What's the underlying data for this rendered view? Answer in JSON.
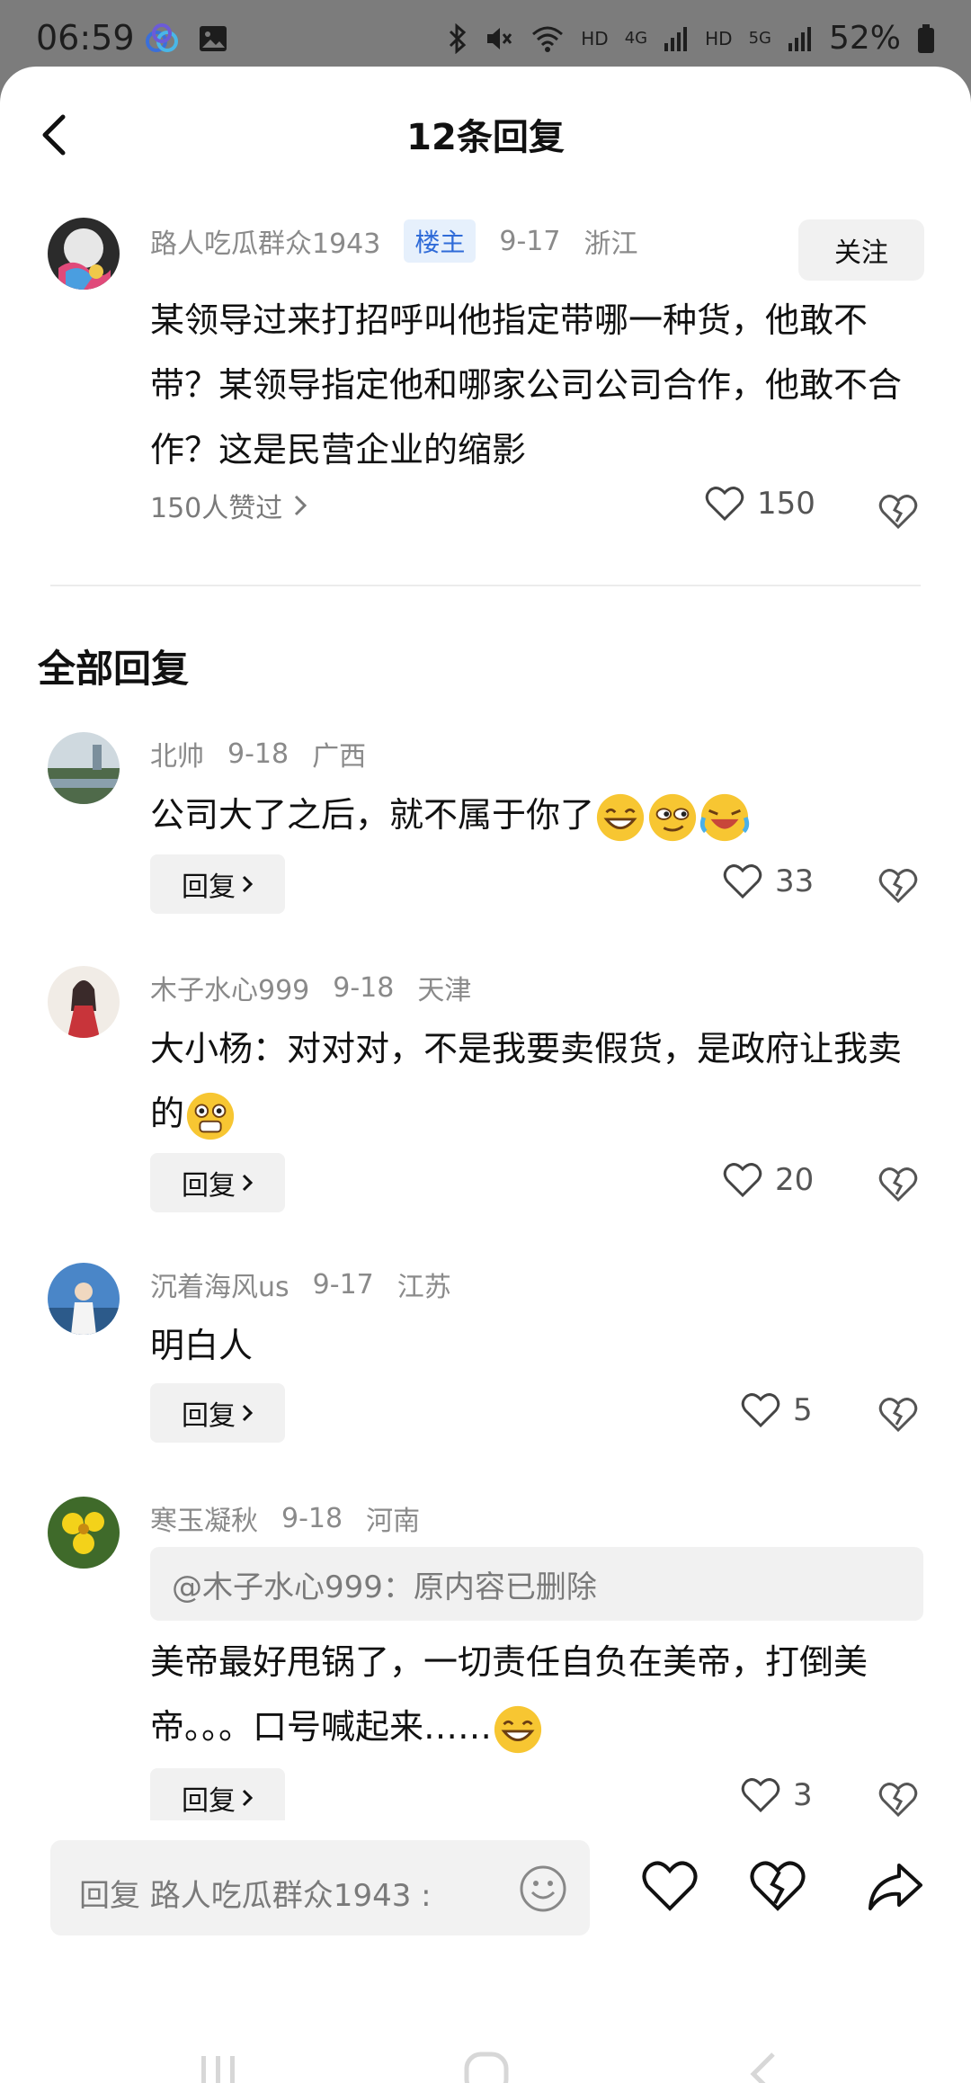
{
  "status_bar": {
    "time": "06:59",
    "hd1": "HD",
    "net1": "4G",
    "hd2": "HD",
    "net2": "5G",
    "battery": "52%"
  },
  "header": {
    "title": "12条回复"
  },
  "main_comment": {
    "user": "路人吃瓜群众1943",
    "badge": "楼主",
    "date": "9-17",
    "location": "浙江",
    "follow_label": "关注",
    "text": "某领导过来打招呼叫他指定带哪一种货，他敢不带？某领导指定他和哪家公司公司合作，他敢不合作？这是民营企业的缩影",
    "likes_summary": "150人赞过",
    "like_count": "150"
  },
  "section_title": "全部回复",
  "reply_label": "回复",
  "replies": [
    {
      "user": "北帅",
      "date": "9-18",
      "location": "广西",
      "text": "公司大了之后，就不属于你了",
      "like_count": "33"
    },
    {
      "user": "木子水心999",
      "date": "9-18",
      "location": "天津",
      "text": "大小杨：对对对，不是我要卖假货，是政府让我卖的",
      "like_count": "20"
    },
    {
      "user": "沉着海风us",
      "date": "9-17",
      "location": "江苏",
      "text": "明白人",
      "like_count": "5"
    },
    {
      "user": "寒玉凝秋",
      "date": "9-18",
      "location": "河南",
      "quote": "@木子水心999：原内容已删除",
      "text": "美帝最好甩锅了，一切责任自负在美帝，打倒美帝。。。口号喊起来……",
      "like_count": "3"
    }
  ],
  "bottom_bar": {
    "input_placeholder": "回复 路人吃瓜群众1943 :"
  },
  "colors": {
    "accent": "#2f6bd8",
    "badge_bg": "#e6f0fc",
    "button_bg": "#f1f1f1"
  }
}
